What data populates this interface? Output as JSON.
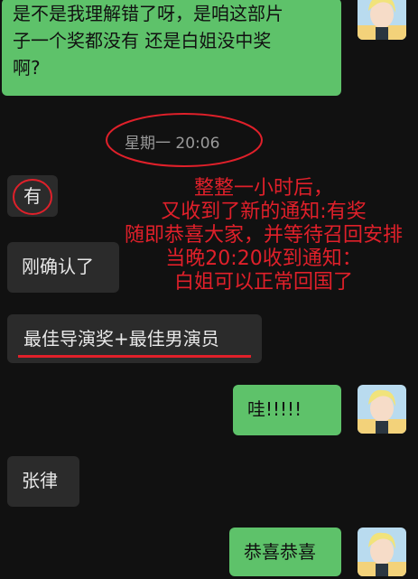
{
  "messages": [
    {
      "side": "sent",
      "text_lines": [
        "是不是我理解错了呀，是咱这部片",
        "子一个奖都没有 还是白姐没中奖",
        "啊?"
      ]
    },
    {
      "side": "recv",
      "text": "有"
    },
    {
      "side": "recv",
      "text": "刚确认了"
    },
    {
      "side": "recv",
      "text": "最佳导演奖+最佳男演员"
    },
    {
      "side": "sent",
      "text": "哇!!!!!"
    },
    {
      "side": "recv",
      "text": "张律"
    },
    {
      "side": "sent",
      "text": "恭喜恭喜"
    }
  ],
  "timestamp": "星期一 20:06",
  "annotation_lines": [
    "整整一小时后，",
    "又收到了新的通知:有奖",
    "随即恭喜大家，并等待召回安排",
    "当晚20:20收到通知：",
    "白姐可以正常回国了"
  ],
  "colors": {
    "sent_bubble": "#5ec26a",
    "recv_bubble": "#2b2b2b",
    "background": "#111111",
    "annotation": "#e0202a"
  },
  "avatar_icon": "user-avatar-icon"
}
